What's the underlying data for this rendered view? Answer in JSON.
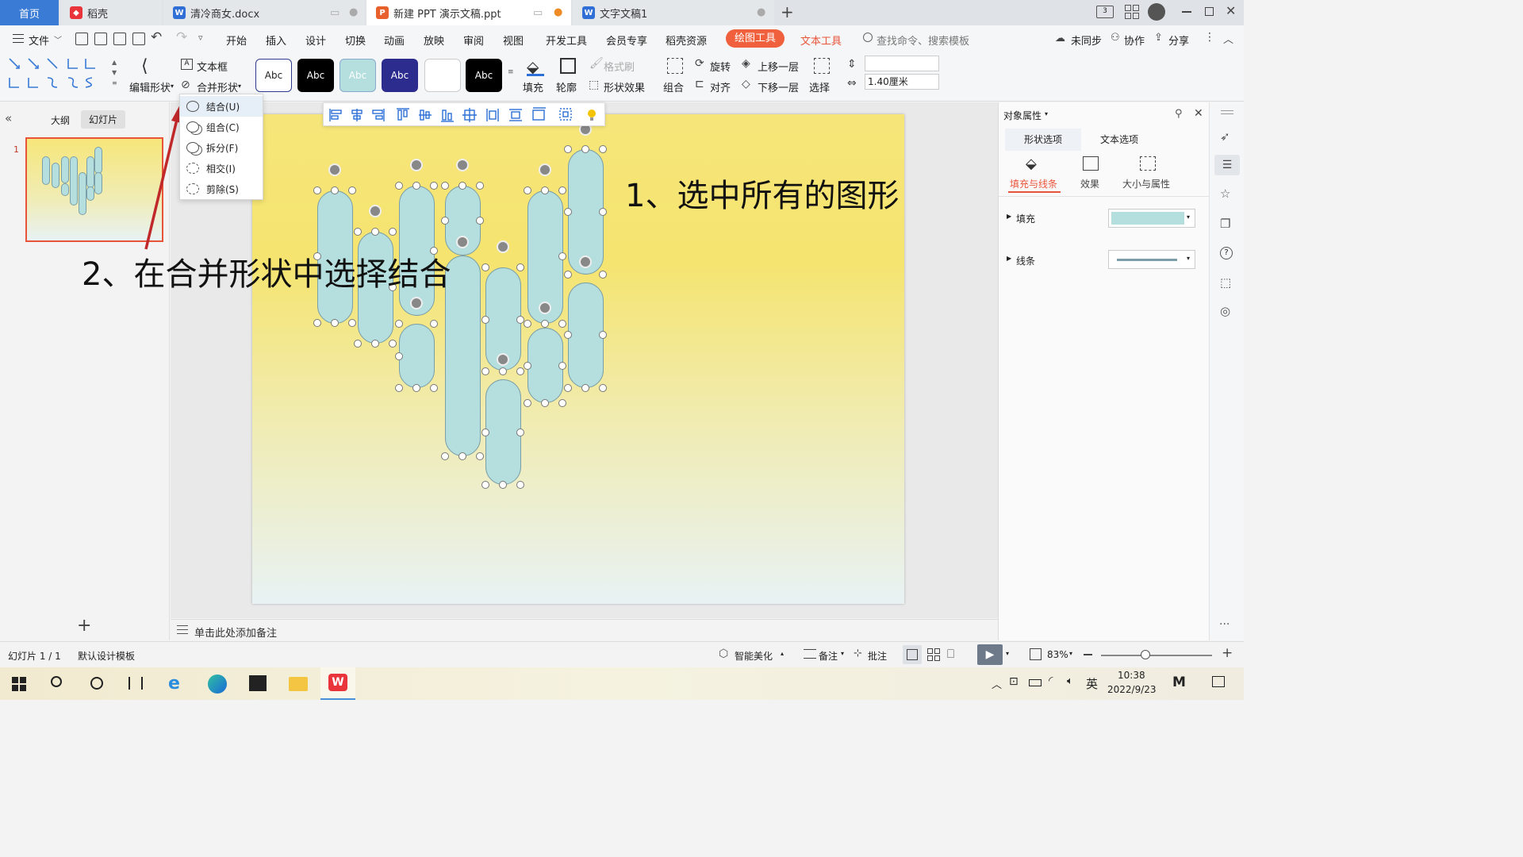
{
  "tabs": [
    {
      "label": "首页",
      "active": true
    },
    {
      "label": "稻壳"
    },
    {
      "label": "清冷商女.docx"
    },
    {
      "label": "新建 PPT 演示文稿.ppt",
      "current": true
    },
    {
      "label": "文字文稿1"
    }
  ],
  "tabbar_new": "+",
  "menu": {
    "file": "文件",
    "items": [
      "开始",
      "插入",
      "设计",
      "切换",
      "动画",
      "放映",
      "审阅",
      "视图",
      "开发工具",
      "会员专享",
      "稻壳资源"
    ],
    "draw_tools": "绘图工具",
    "text_tools": "文本工具",
    "search_placeholder": "查找命令、搜索模板",
    "unsynced": "未同步",
    "collab": "协作",
    "share": "分享"
  },
  "ribbon": {
    "edit_shape": "编辑形状",
    "textbox": "文本框",
    "merge_shapes": "合并形状",
    "style_label": "Abc",
    "fill": "填充",
    "outline": "轮廓",
    "format_painter": "格式刷",
    "shape_effects": "形状效果",
    "group": "组合",
    "rotate": "旋转",
    "align": "对齐",
    "bring_forward": "上移一层",
    "send_backward": "下移一层",
    "select": "选择",
    "height_value": "",
    "width_value": "1.40厘米"
  },
  "merge_menu": [
    {
      "label": "结合(U)"
    },
    {
      "label": "组合(C)"
    },
    {
      "label": "拆分(F)"
    },
    {
      "label": "相交(I)"
    },
    {
      "label": "剪除(S)"
    }
  ],
  "leftpane": {
    "outline_tab": "大纲",
    "slides_tab": "幻灯片",
    "slide_number": "1",
    "add": "+"
  },
  "annotations": {
    "step1": "1、选中所有的图形",
    "step2": "2、在合并形状中选择结合"
  },
  "notes_placeholder": "单击此处添加备注",
  "rightpanel": {
    "title": "对象属性",
    "tab_shape": "形状选项",
    "tab_text": "文本选项",
    "sub_fill_line": "填充与线条",
    "sub_effects": "效果",
    "sub_size": "大小与属性",
    "fill_label": "填充",
    "line_label": "线条",
    "fill_color": "#b5dede"
  },
  "statusbar": {
    "slide_info": "幻灯片 1 / 1",
    "template": "默认设计模板",
    "beautify": "智能美化",
    "notes": "备注",
    "comments": "批注",
    "zoom": "83%"
  },
  "taskbar": {
    "time": "10:38",
    "date": "2022/9/23",
    "ime": "英"
  },
  "colors": {
    "accent_red": "#e8543a",
    "draw_tools_bg": "#f0603c",
    "text_tools": "#e8543a",
    "tab_active": "#3a7bd5",
    "shape_fill": "#b5dede",
    "arrow": "#c0282a"
  }
}
